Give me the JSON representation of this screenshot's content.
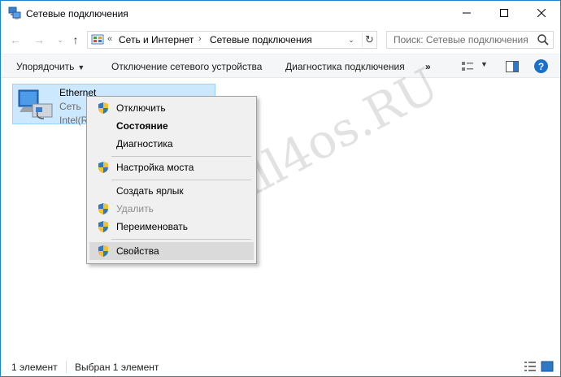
{
  "window": {
    "title": "Сетевые подключения",
    "icon": "network-connections-icon"
  },
  "titlebar_buttons": {
    "minimize": "—",
    "maximize": "☐",
    "close": "✕"
  },
  "nav": {
    "back": "←",
    "forward": "→",
    "recent": "⌄",
    "up": "↑"
  },
  "address": {
    "prefix": "«",
    "crumbs": [
      "Сеть и Интернет",
      "Сетевые подключения"
    ],
    "separator": "›",
    "refresh": "↻",
    "dropdown": "⌄"
  },
  "search": {
    "placeholder": "Поиск: Сетевые подключения"
  },
  "toolbar": {
    "organize": "Упорядочить",
    "disable": "Отключение сетевого устройства",
    "diagnose": "Диагностика подключения",
    "more": "»",
    "help": "?",
    "caret": "▼"
  },
  "connection": {
    "name": "Ethernet",
    "status": "Сеть",
    "device": "Intel(R)"
  },
  "watermark": "All4os.RU",
  "context_menu": {
    "items": [
      {
        "label": "Отключить",
        "shield": true,
        "bold": false,
        "disabled": false
      },
      {
        "label": "Состояние",
        "shield": false,
        "bold": true,
        "disabled": false
      },
      {
        "label": "Диагностика",
        "shield": false,
        "bold": false,
        "disabled": false
      },
      {
        "label": "Настройка моста",
        "shield": true,
        "bold": false,
        "disabled": false
      },
      {
        "label": "Создать ярлык",
        "shield": false,
        "bold": false,
        "disabled": false
      },
      {
        "label": "Удалить",
        "shield": true,
        "bold": false,
        "disabled": true
      },
      {
        "label": "Переименовать",
        "shield": true,
        "bold": false,
        "disabled": false
      },
      {
        "label": "Свойства",
        "shield": true,
        "bold": false,
        "disabled": false,
        "highlighted": true
      }
    ]
  },
  "status": {
    "count": "1 элемент",
    "selected": "Выбран 1 элемент"
  },
  "colors": {
    "selection_bg": "#cce8ff",
    "selection_border": "#99d1ff",
    "accent_border": "#1883d7",
    "help_blue": "#1a6fc9"
  }
}
